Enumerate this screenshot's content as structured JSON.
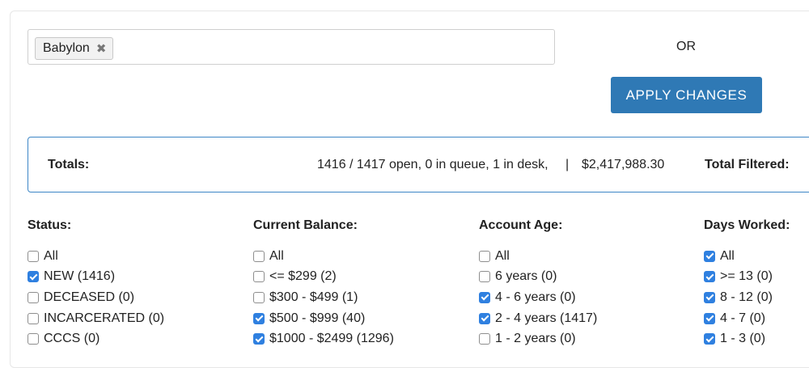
{
  "search": {
    "tag_label": "Babylon",
    "tag_remove_glyph": "✖"
  },
  "or_label": "OR",
  "apply_button_label": "APPLY CHANGES",
  "totals": {
    "label": "Totals:",
    "summary": "1416 / 1417 open, 0 in queue, 1 in desk,",
    "separator": "|",
    "amount": "$2,417,988.30",
    "filtered_label": "Total Filtered:"
  },
  "filters": [
    {
      "title": "Status:",
      "options": [
        {
          "label": "All",
          "checked": false
        },
        {
          "label": "NEW (1416)",
          "checked": true
        },
        {
          "label": "DECEASED (0)",
          "checked": false
        },
        {
          "label": "INCARCERATED (0)",
          "checked": false
        },
        {
          "label": "CCCS (0)",
          "checked": false
        }
      ]
    },
    {
      "title": "Current Balance:",
      "options": [
        {
          "label": "All",
          "checked": false
        },
        {
          "label": "<= $299 (2)",
          "checked": false
        },
        {
          "label": "$300 - $499 (1)",
          "checked": false
        },
        {
          "label": "$500 - $999 (40)",
          "checked": true
        },
        {
          "label": "$1000 - $2499 (1296)",
          "checked": true
        }
      ]
    },
    {
      "title": "Account Age:",
      "options": [
        {
          "label": "All",
          "checked": false
        },
        {
          "label": "6 years (0)",
          "checked": false
        },
        {
          "label": "4 - 6 years (0)",
          "checked": true
        },
        {
          "label": "2 - 4 years (1417)",
          "checked": true
        },
        {
          "label": "1 - 2 years (0)",
          "checked": false
        }
      ]
    },
    {
      "title": "Days Worked:",
      "options": [
        {
          "label": "All",
          "checked": true
        },
        {
          "label": ">= 13 (0)",
          "checked": true
        },
        {
          "label": "8 - 12 (0)",
          "checked": true
        },
        {
          "label": "4 - 7 (0)",
          "checked": true
        },
        {
          "label": "1 - 3 (0)",
          "checked": true
        }
      ]
    }
  ]
}
